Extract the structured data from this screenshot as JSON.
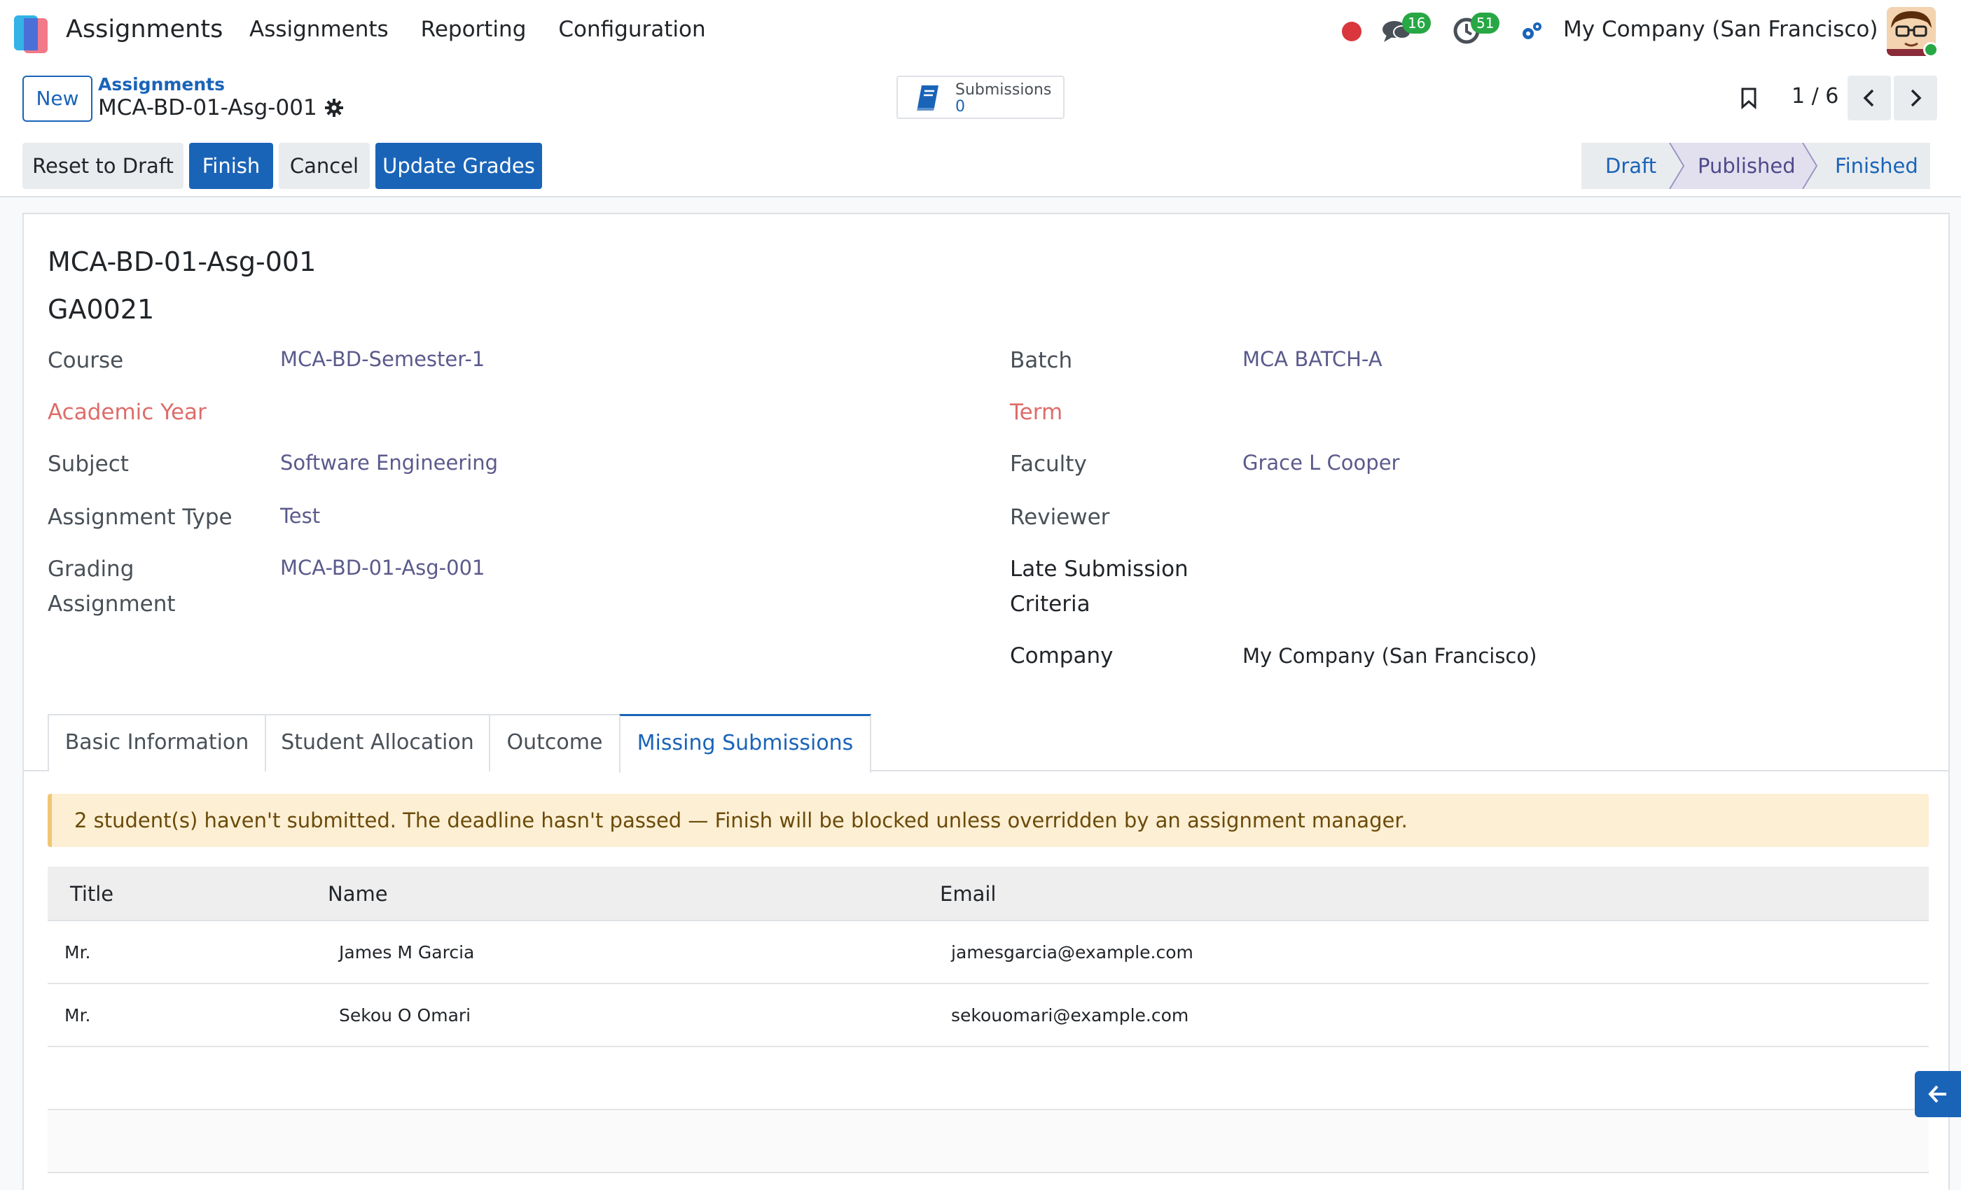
{
  "navbar": {
    "app_name": "Assignments",
    "menu": [
      "Assignments",
      "Reporting",
      "Configuration"
    ],
    "messages_count": "16",
    "activities_count": "51",
    "company": "My Company (San Francisco)"
  },
  "control_panel": {
    "new_label": "New",
    "breadcrumb_parent": "Assignments",
    "breadcrumb_current": "MCA-BD-01-Asg-001",
    "smart_button": {
      "label": "Submissions",
      "value": "0"
    },
    "pager": "1 / 6",
    "actions": {
      "reset_to_draft": "Reset to Draft",
      "finish": "Finish",
      "cancel": "Cancel",
      "update_grades": "Update Grades"
    },
    "stages": {
      "draft": "Draft",
      "published": "Published",
      "finished": "Finished"
    },
    "current_stage": "Published"
  },
  "form": {
    "name": "MCA-BD-01-Asg-001",
    "code": "GA0021",
    "left_fields": {
      "course_label": "Course",
      "course_value": "MCA-BD-Semester-1",
      "academic_year_label": "Academic Year",
      "subject_label": "Subject",
      "subject_value": "Software Engineering",
      "assignment_type_label": "Assignment Type",
      "assignment_type_value": "Test",
      "grading_label_1": "Grading",
      "grading_label_2": "Assignment",
      "grading_value": "MCA-BD-01-Asg-001"
    },
    "right_fields": {
      "batch_label": "Batch",
      "batch_value": "MCA BATCH-A",
      "term_label": "Term",
      "faculty_label": "Faculty",
      "faculty_value": "Grace L Cooper",
      "reviewer_label": "Reviewer",
      "late_label_1": "Late Submission",
      "late_label_2": "Criteria",
      "company_label": "Company",
      "company_value": "My Company (San Francisco)"
    },
    "tabs": [
      "Basic Information",
      "Student Allocation",
      "Outcome",
      "Missing Submissions"
    ],
    "active_tab": "Missing Submissions",
    "alert": "2 student(s) haven't submitted. The deadline hasn't passed — Finish will be blocked unless overridden by an assignment manager.",
    "table": {
      "headers": [
        "Title",
        "Name",
        "Email"
      ],
      "rows": [
        {
          "title": "Mr.",
          "name": "James M Garcia",
          "email": "jamesgarcia@example.com"
        },
        {
          "title": "Mr.",
          "name": "Sekou O Omari",
          "email": "sekouomari@example.com"
        }
      ]
    }
  },
  "colors": {
    "primary": "#1a64b8",
    "badge": "#28a745",
    "required_label": "#d9534f",
    "alert_bg": "#fcefd3"
  }
}
